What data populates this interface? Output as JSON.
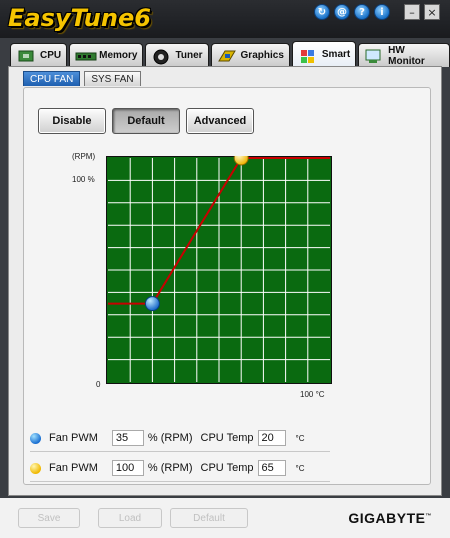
{
  "app": {
    "logo_text": "EasyTune6",
    "title_icons": [
      "at-icon",
      "at-icon",
      "help-icon",
      "info-icon"
    ],
    "title_icon_glyphs": [
      "↻",
      "@",
      "?",
      "i"
    ],
    "window_buttons": [
      "–",
      "×"
    ]
  },
  "tabs": [
    {
      "label": "CPU",
      "icon": "cpu-chip-icon"
    },
    {
      "label": "Memory",
      "icon": "memory-stick-icon"
    },
    {
      "label": "Tuner",
      "icon": "tuner-dial-icon"
    },
    {
      "label": "Graphics",
      "icon": "graphics-card-icon"
    },
    {
      "label": "Smart",
      "icon": "smart-cube-icon",
      "active": true
    },
    {
      "label": "HW Monitor",
      "icon": "hw-monitor-icon"
    }
  ],
  "subtabs": [
    {
      "label": "CPU FAN",
      "active": true
    },
    {
      "label": "SYS FAN",
      "active": false
    }
  ],
  "mode_buttons": {
    "disable": "Disable",
    "default": "Default",
    "advanced": "Advanced"
  },
  "chart_data": {
    "type": "line",
    "ylabel": "(RPM)",
    "y_top_label": "100 %",
    "y_origin_label": "0",
    "x_end_label": "100",
    "x_end_unit": "°C",
    "grid": true,
    "grid_color": "#ffffff",
    "background_color": "#0a6a10",
    "line_color": "#c80000",
    "xlim": [
      0,
      100
    ],
    "ylim": [
      0,
      100
    ],
    "x": [
      0,
      20,
      60,
      100
    ],
    "y": [
      35,
      35,
      100,
      100
    ],
    "control_points": [
      {
        "x": 20,
        "y": 35,
        "color": "blue"
      },
      {
        "x": 60,
        "y": 100,
        "color": "yellow"
      }
    ]
  },
  "points": [
    {
      "color": "blue",
      "pwm_label": "Fan PWM",
      "pwm_value": "35",
      "pwm_unit": "% (RPM)",
      "temp_label": "CPU Temp",
      "temp_value": "20",
      "temp_unit": "°C"
    },
    {
      "color": "yellow",
      "pwm_label": "Fan PWM",
      "pwm_value": "100",
      "pwm_unit": "% (RPM)",
      "temp_label": "CPU Temp",
      "temp_value": "65",
      "temp_unit": "°C"
    }
  ],
  "bottom": {
    "save": "Save",
    "load": "Load",
    "default": "Default",
    "brand": "GIGABYTE",
    "brand_tm": "™"
  }
}
